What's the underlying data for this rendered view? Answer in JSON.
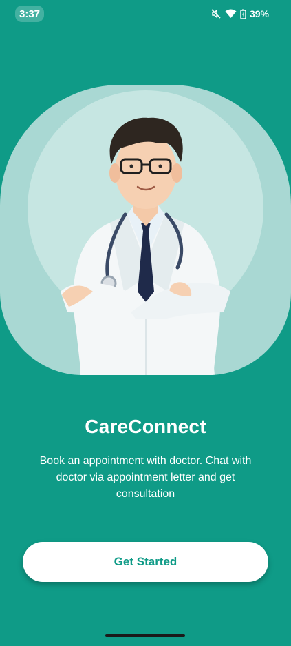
{
  "status_bar": {
    "time": "3:37",
    "battery": "39%",
    "icons": [
      "mute-icon",
      "wifi-icon",
      "battery-charging-icon"
    ]
  },
  "main": {
    "title": "CareConnect",
    "description": "Book an appointment with doctor. Chat with doctor via appointment letter and get consultation",
    "cta_label": "Get Started"
  },
  "colors": {
    "background": "#0F9B87",
    "hero_outer": "#A9D8D3",
    "hero_inner": "#C6E6E2",
    "button_bg": "#FFFFFF",
    "button_text": "#0F9B87"
  }
}
